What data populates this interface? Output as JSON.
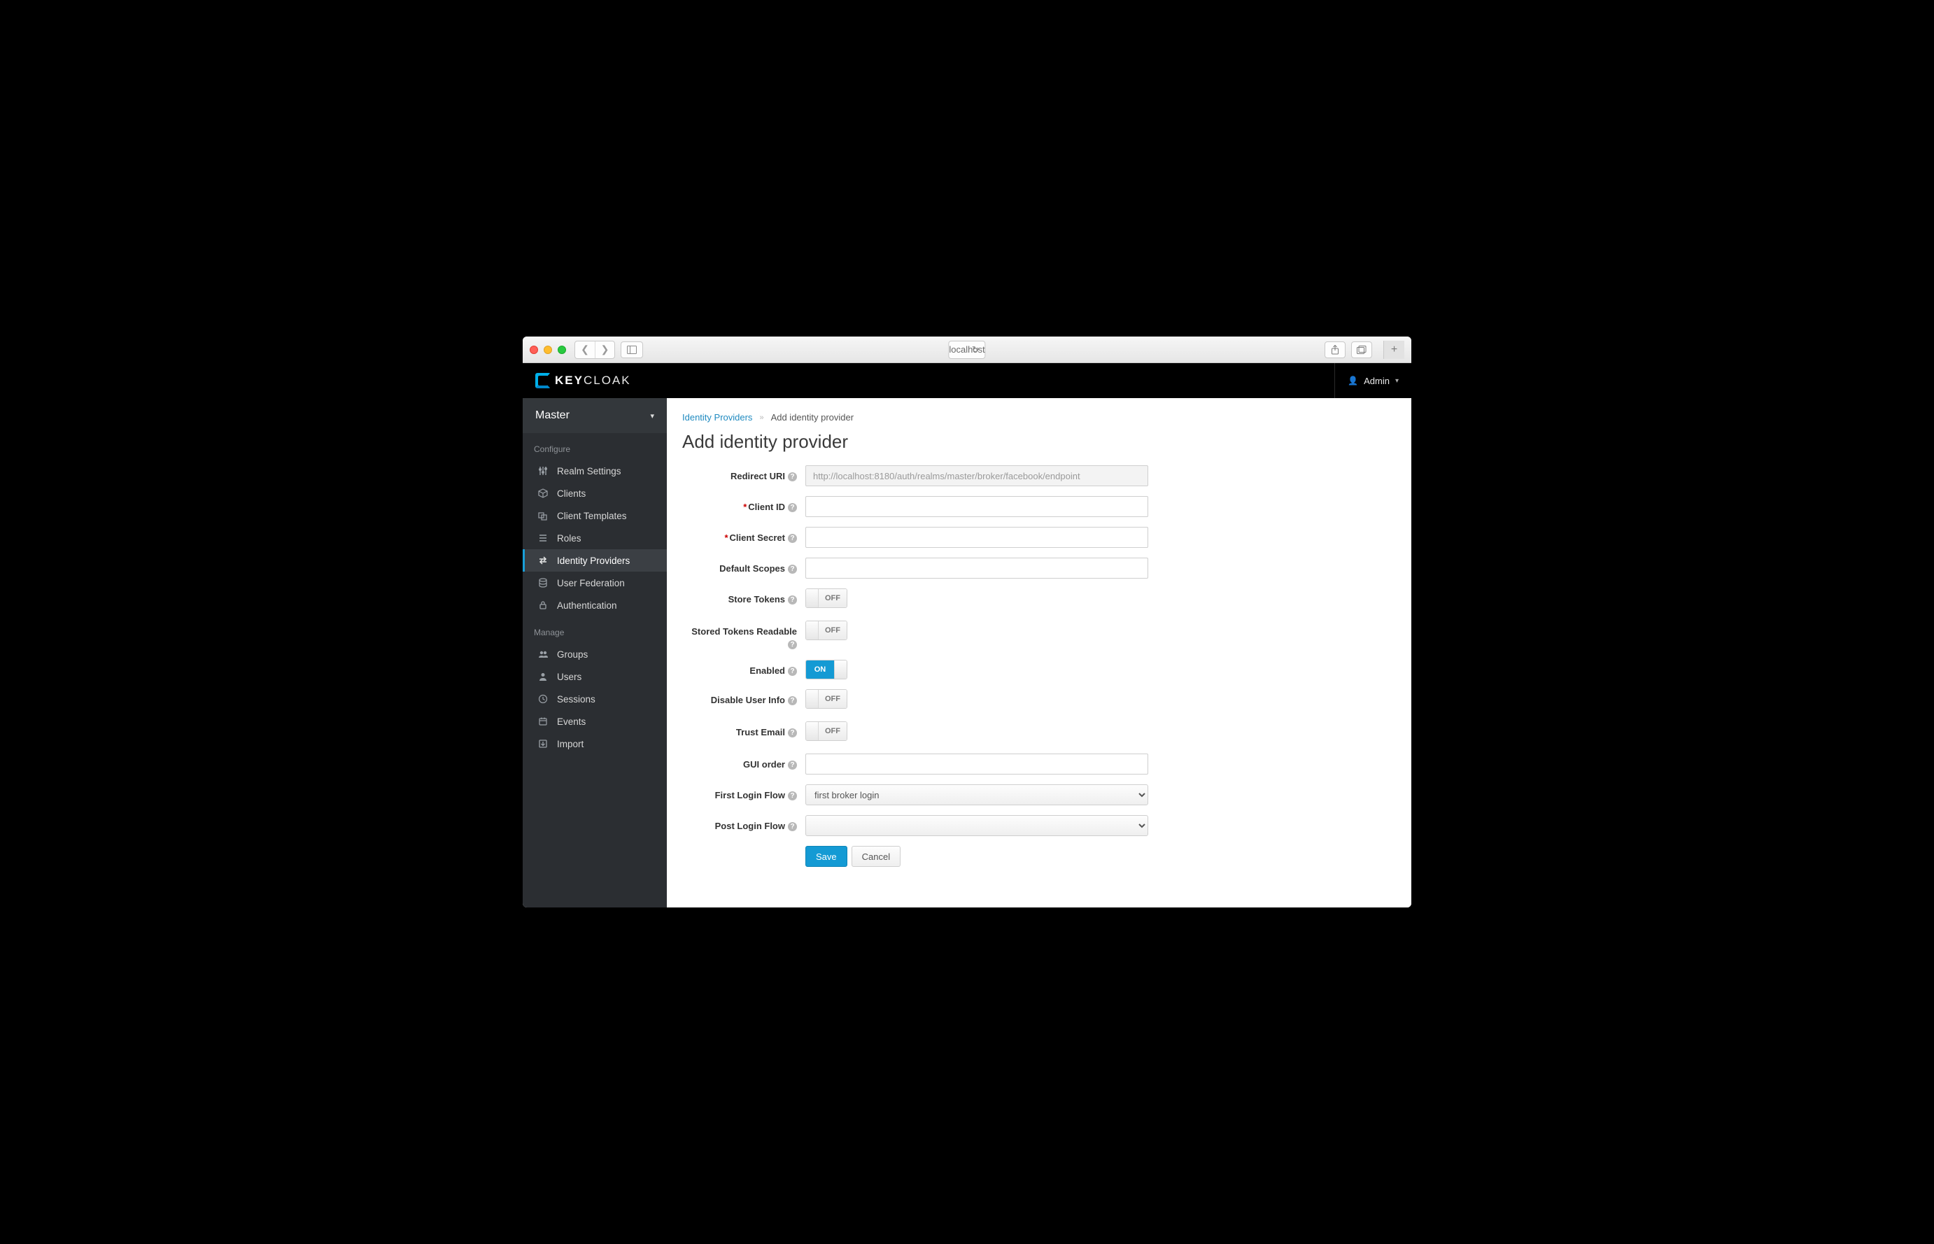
{
  "browser": {
    "url": "localhost"
  },
  "header": {
    "brand_key": "KEY",
    "brand_cloak": "CLOAK",
    "user": "Admin"
  },
  "realm": {
    "name": "Master"
  },
  "sidebar": {
    "section_configure": "Configure",
    "section_manage": "Manage",
    "configure": [
      {
        "label": "Realm Settings",
        "icon": "sliders-icon"
      },
      {
        "label": "Clients",
        "icon": "cube-icon"
      },
      {
        "label": "Client Templates",
        "icon": "templates-icon"
      },
      {
        "label": "Roles",
        "icon": "list-icon"
      },
      {
        "label": "Identity Providers",
        "icon": "exchange-icon",
        "active": true
      },
      {
        "label": "User Federation",
        "icon": "database-icon"
      },
      {
        "label": "Authentication",
        "icon": "lock-icon"
      }
    ],
    "manage": [
      {
        "label": "Groups",
        "icon": "group-icon"
      },
      {
        "label": "Users",
        "icon": "user-icon"
      },
      {
        "label": "Sessions",
        "icon": "clock-icon"
      },
      {
        "label": "Events",
        "icon": "calendar-icon"
      },
      {
        "label": "Import",
        "icon": "import-icon"
      }
    ]
  },
  "breadcrumb": {
    "parent": "Identity Providers",
    "current": "Add identity provider"
  },
  "page": {
    "title": "Add identity provider"
  },
  "form": {
    "redirect_uri": {
      "label": "Redirect URI",
      "value": "http://localhost:8180/auth/realms/master/broker/facebook/endpoint"
    },
    "client_id": {
      "label": "Client ID",
      "value": "",
      "required": true
    },
    "client_secret": {
      "label": "Client Secret",
      "value": "",
      "required": true
    },
    "default_scopes": {
      "label": "Default Scopes",
      "value": ""
    },
    "store_tokens": {
      "label": "Store Tokens",
      "value": "OFF"
    },
    "stored_tokens_readable": {
      "label": "Stored Tokens Readable",
      "value": "OFF"
    },
    "enabled": {
      "label": "Enabled",
      "value": "ON"
    },
    "disable_user_info": {
      "label": "Disable User Info",
      "value": "OFF"
    },
    "trust_email": {
      "label": "Trust Email",
      "value": "OFF"
    },
    "gui_order": {
      "label": "GUI order",
      "value": ""
    },
    "first_login_flow": {
      "label": "First Login Flow",
      "value": "first broker login"
    },
    "post_login_flow": {
      "label": "Post Login Flow",
      "value": ""
    }
  },
  "buttons": {
    "save": "Save",
    "cancel": "Cancel"
  }
}
